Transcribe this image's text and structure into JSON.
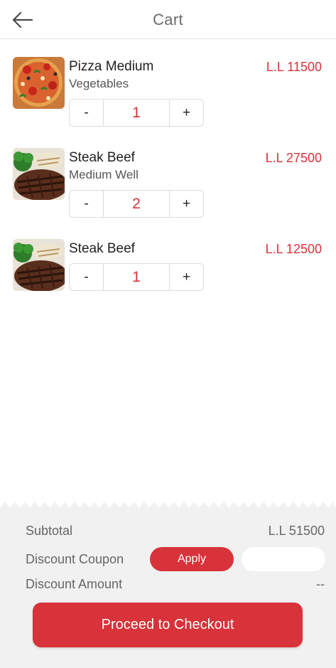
{
  "header": {
    "title": "Cart",
    "back_icon": "arrow-left-icon"
  },
  "items": [
    {
      "name": "Pizza Medium",
      "subtitle": "Vegetables",
      "price": "L.L 11500",
      "quantity": "1",
      "minus_label": "-",
      "plus_label": "+",
      "image": "pizza-image"
    },
    {
      "name": "Steak Beef",
      "subtitle": "Medium Well",
      "price": "L.L 27500",
      "quantity": "2",
      "minus_label": "-",
      "plus_label": "+",
      "image": "steak-image"
    },
    {
      "name": "Steak Beef",
      "subtitle": "",
      "price": "L.L 12500",
      "quantity": "1",
      "minus_label": "-",
      "plus_label": "+",
      "image": "steak-image"
    }
  ],
  "summary": {
    "subtotal_label": "Subtotal",
    "subtotal_value": "L.L 51500",
    "coupon_label": "Discount Coupon",
    "apply_label": "Apply",
    "coupon_value": "",
    "discount_label": "Discount Amount",
    "discount_value": "--",
    "checkout_label": "Proceed to Checkout"
  },
  "colors": {
    "accent": "#d8333a",
    "summary_bg": "#f1f1f1",
    "divider": "#e3e3e3"
  }
}
